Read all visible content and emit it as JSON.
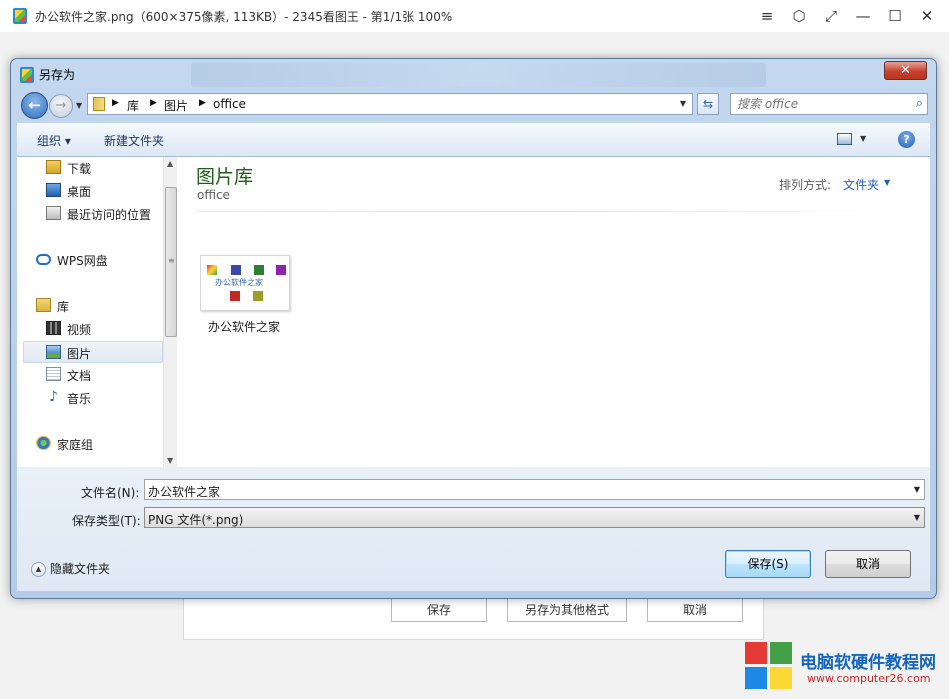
{
  "viewer": {
    "title": "办公软件之家.png（600×375像素, 113KB）- 2345看图王 - 第1/1张 100%",
    "controls": [
      "≡",
      "⬡",
      "⤢",
      "—",
      "☐",
      "✕"
    ]
  },
  "dialog": {
    "title": "另存为",
    "close_label": "✕",
    "breadcrumbs": [
      "库",
      "图片",
      "office"
    ],
    "search_placeholder": "搜索 office",
    "toolbar": {
      "organize": "组织 ▾",
      "new_folder": "新建文件夹"
    },
    "nav_items": [
      {
        "label": "下载",
        "icon": "download-folder-icon"
      },
      {
        "label": "桌面",
        "icon": "desktop-icon"
      },
      {
        "label": "最近访问的位置",
        "icon": "recent-places-icon"
      },
      {
        "label": "WPS网盘",
        "icon": "cloud-drive-icon"
      },
      {
        "label": "库",
        "icon": "library-icon"
      },
      {
        "label": "视频",
        "icon": "video-icon"
      },
      {
        "label": "图片",
        "icon": "pictures-icon",
        "selected": true
      },
      {
        "label": "文档",
        "icon": "documents-icon"
      },
      {
        "label": "音乐",
        "icon": "music-icon"
      },
      {
        "label": "家庭组",
        "icon": "homegroup-icon"
      }
    ],
    "library": {
      "title": "图片库",
      "subtitle": "office",
      "arrange_label": "排列方式:",
      "arrange_value": "文件夹"
    },
    "files": [
      {
        "name": "办公软件之家",
        "thumb_text": "办公软件之家"
      }
    ],
    "form": {
      "filename_label": "文件名(N):",
      "filename_value": "办公软件之家",
      "filetype_label": "保存类型(T):",
      "filetype_value": "PNG 文件(*.png)"
    },
    "hide_folders_label": "隐藏文件夹",
    "save_button": "保存(S)",
    "cancel_button": "取消"
  },
  "background_dialog": {
    "buttons": [
      "保存",
      "另存为其他格式",
      "取消"
    ]
  },
  "watermark": {
    "line1": "电脑软硬件教程网",
    "line2": "www.computer26.com"
  }
}
